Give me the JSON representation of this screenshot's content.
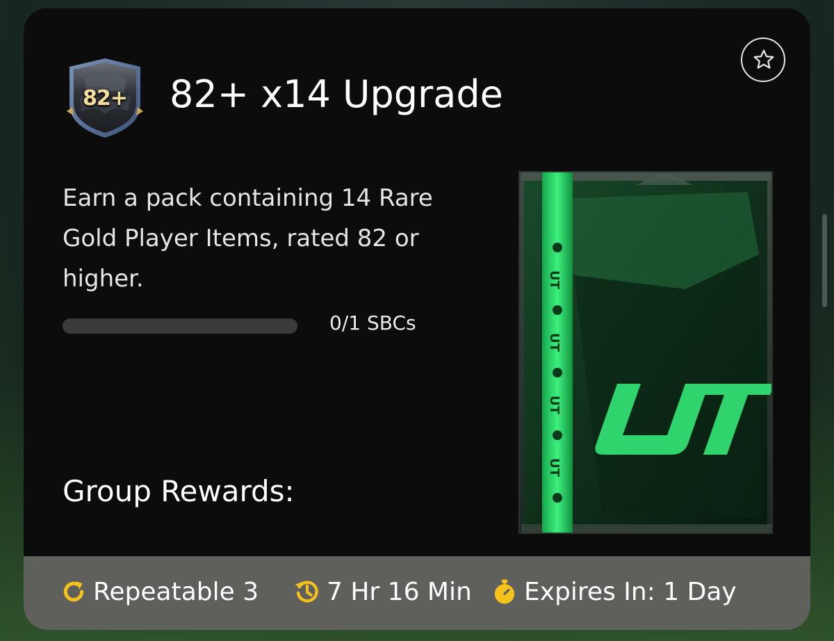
{
  "card": {
    "badge_text": "82+",
    "title": "82+ x14 Upgrade",
    "description": "Earn a pack containing 14 Rare Gold Player Items, rated 82 or higher.",
    "progress": {
      "fraction": 0,
      "label": "0/1 SBCs"
    },
    "group_rewards_label": "Group Rewards:",
    "pack": {
      "logo_text": "UT",
      "strip_text": "UT"
    }
  },
  "footer": {
    "repeatable": "Repeatable 3",
    "refresh_time": "7 Hr 16 Min",
    "expires": "Expires In: 1 Day"
  },
  "colors": {
    "card_bg": "#0c0c0c",
    "footer_bg": "#5f5f5b",
    "accent_yellow": "#f5c21b",
    "pack_green": "#2fd46c",
    "badge_gold": "#f6dc9a"
  },
  "icons": {
    "favorite": "star-outline-icon",
    "repeatable": "refresh-icon",
    "refresh": "history-clock-icon",
    "expires": "stopwatch-icon"
  }
}
